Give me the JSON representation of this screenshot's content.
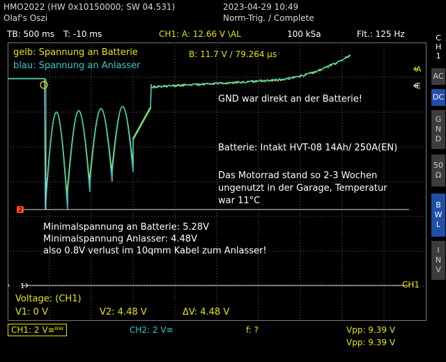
{
  "header": {
    "device": "HMO2022 (HW 0x10150000; SW 04.531)",
    "owner": "Olaf's Oszi",
    "datetime": "2023-04-29 10:49",
    "trigger_status": "Norm-Trig. / Complete"
  },
  "top_bar": {
    "timebase": "TB: 500 ms",
    "trigger_time": "T: -10 ms",
    "ch1_trigger": "CH1: A: 12.66 V \\AL",
    "sample_rate": "100 kSa",
    "filter": "Flt.: 125 Hz"
  },
  "sidebar": {
    "ch1_label": [
      "C",
      "H",
      "1"
    ],
    "buttons": [
      {
        "lines": [
          "AC"
        ],
        "active": false
      },
      {
        "lines": [
          "DC"
        ],
        "active": true
      },
      {
        "lines": [
          "G",
          "N",
          "D"
        ],
        "active": false
      },
      {
        "lines": [
          "50",
          "Ω"
        ],
        "active": false
      },
      {
        "lines": [
          "B",
          "W",
          "L"
        ],
        "active": true
      },
      {
        "lines": [
          "I",
          "N",
          "V"
        ],
        "active": false
      }
    ]
  },
  "legend": {
    "yellow": "gelb: Spannung an Batterie",
    "blue": "blau: Spannung an Anlasser"
  },
  "cursor_readout": "B: 11.7 V / 79.264 µs",
  "annotations": {
    "gnd": "GND war direkt an der Batterie!",
    "battery": "Batterie: Intakt HVT-08 14Ah/ 250A(EN)",
    "note": [
      "Das Motorrad stand so 2-3 Wochen",
      "ungenutzt in der Garage, Temperatur",
      "war 11°C"
    ],
    "minimum": [
      "Minimalspannung an Batterie: 5.28V",
      "Minimalspannung Anlasser: 4.48V",
      "also 0.8V verlust im 10qmm Kabel zum Anlasser!"
    ]
  },
  "markers": {
    "a": "A",
    "e": "E",
    "ch1_right": "CH1",
    "ground_1": "1",
    "ref_2": "2"
  },
  "measurement": {
    "title": "Voltage: (CH1)",
    "v1": "V1: 0 V",
    "v2": "V2: 4.48 V",
    "dv": "ΔV: 4.48 V"
  },
  "bottom_bar": {
    "ch1": "CH1: 2 V≅ᴮᵂ",
    "ch2": "CH2: 2 V≅",
    "f": "f: ?",
    "vpp1": "Vpp: 9.39 V",
    "vpp2": "Vpp: 9.39 V"
  },
  "colors": {
    "ch1_yellow": "#e6e600",
    "ch2_cyan": "#33cccc",
    "ref_orange": "#ff4a1a",
    "button_active": "#1f4fa8",
    "button_inactive": "#3c3c3c",
    "grid": "#6a6a6a"
  },
  "icons": {
    "trigger_a": "arrow-left-icon",
    "trigger_e": "arrow-left-icon",
    "ground": "arrow-right-icon"
  }
}
